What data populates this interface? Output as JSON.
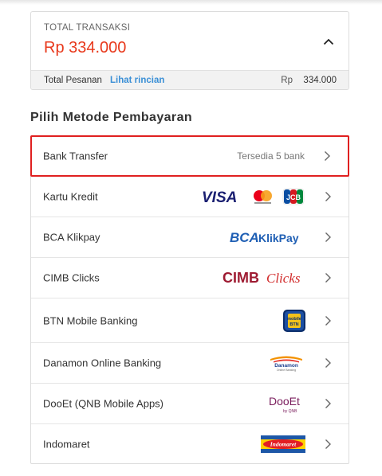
{
  "summary": {
    "label": "TOTAL TRANSAKSI",
    "amount": "Rp 334.000",
    "subtotal_label": "Total Pesanan",
    "details_link": "Lihat rincian",
    "subtotal_currency": "Rp",
    "subtotal_value": "334.000",
    "collapse_icon": "chevron-up-icon"
  },
  "payment": {
    "title": "Pilih Metode Pembayaran",
    "methods": [
      {
        "name": "Bank Transfer",
        "note": "Tersedia 5 bank",
        "selected": true
      },
      {
        "name": "Kartu Kredit",
        "logo": "visa-mastercard-jcb-logos",
        "logo_text": [
          "VISA",
          "JCB"
        ]
      },
      {
        "name": "BCA Klikpay",
        "logo": "bca-klikpay-logo",
        "logo_text": [
          "BCA",
          "KlikPay"
        ]
      },
      {
        "name": "CIMB Clicks",
        "logo": "cimb-clicks-logo",
        "logo_text": [
          "CIMB",
          "Clicks"
        ]
      },
      {
        "name": "BTN Mobile Banking",
        "logo": "btn-mobile-app-icon",
        "logo_text": [
          "mobile",
          "BTN"
        ]
      },
      {
        "name": "Danamon Online Banking",
        "logo": "danamon-logo",
        "logo_text": [
          "Danamon",
          "Online Banking"
        ]
      },
      {
        "name": "DooEt (QNB Mobile Apps)",
        "logo": "dooet-qnb-logo",
        "logo_text": [
          "DooEt",
          "by QNB"
        ]
      },
      {
        "name": "Indomaret",
        "logo": "indomaret-logo",
        "logo_text": [
          "Indomaret"
        ]
      }
    ]
  },
  "colors": {
    "accent_red": "#e8381b",
    "selected_border": "#e02020",
    "link_blue": "#3a8fd6"
  }
}
